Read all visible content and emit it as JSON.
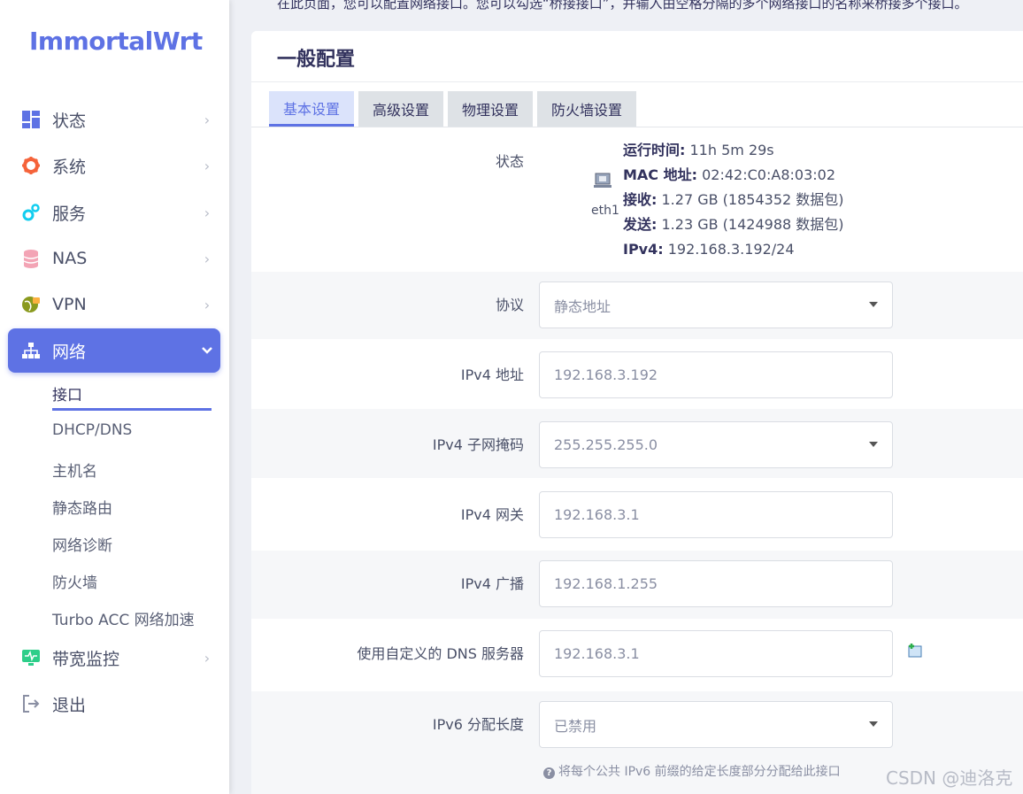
{
  "brand": "ImmortalWrt",
  "top_description": "在此页面，您可以配置网络接口。您可以勾选“桥接接口”，并输入由空格分隔的多个网络接口的名称来桥接多个接口。",
  "sidebar": {
    "items": [
      {
        "label": "状态",
        "icon": "dashboard-icon"
      },
      {
        "label": "系统",
        "icon": "gear-icon"
      },
      {
        "label": "服务",
        "icon": "cogs-icon"
      },
      {
        "label": "NAS",
        "icon": "database-icon"
      },
      {
        "label": "VPN",
        "icon": "globe-lock-icon"
      },
      {
        "label": "网络",
        "icon": "network-icon"
      },
      {
        "label": "带宽监控",
        "icon": "monitor-icon"
      },
      {
        "label": "退出",
        "icon": "logout-icon"
      }
    ],
    "network_sub": [
      "接口",
      "DHCP/DNS",
      "主机名",
      "静态路由",
      "网络诊断",
      "防火墙",
      "Turbo ACC 网络加速"
    ]
  },
  "section_title": "一般配置",
  "tabs": [
    "基本设置",
    "高级设置",
    "物理设置",
    "防火墙设置"
  ],
  "status": {
    "label": "状态",
    "device": "eth1",
    "uptime_label": "运行时间:",
    "uptime": "11h 5m 29s",
    "mac_label": "MAC 地址:",
    "mac": "02:42:C0:A8:03:02",
    "rx_label": "接收:",
    "rx": "1.27 GB (1854352 数据包)",
    "tx_label": "发送:",
    "tx": "1.23 GB (1424988 数据包)",
    "ipv4_label": "IPv4:",
    "ipv4": "192.168.3.192/24"
  },
  "form": {
    "protocol_label": "协议",
    "protocol": "静态地址",
    "ipv4_addr_label": "IPv4 地址",
    "ipv4_addr": "192.168.3.192",
    "netmask_label": "IPv4 子网掩码",
    "netmask": "255.255.255.0",
    "gateway_label": "IPv4 网关",
    "gateway": "192.168.3.1",
    "broadcast_label": "IPv4 广播",
    "broadcast": "192.168.1.255",
    "dns_label": "使用自定义的 DNS 服务器",
    "dns": "192.168.3.1",
    "ipv6_len_label": "IPv6 分配长度",
    "ipv6_len": "已禁用",
    "ipv6_hint": "将每个公共 IPv6 前缀的给定长度部分分配给此接口"
  },
  "watermark": "CSDN @迪洛克",
  "colors": {
    "accent": "#5e72e4",
    "brand": "#5e72e4"
  }
}
